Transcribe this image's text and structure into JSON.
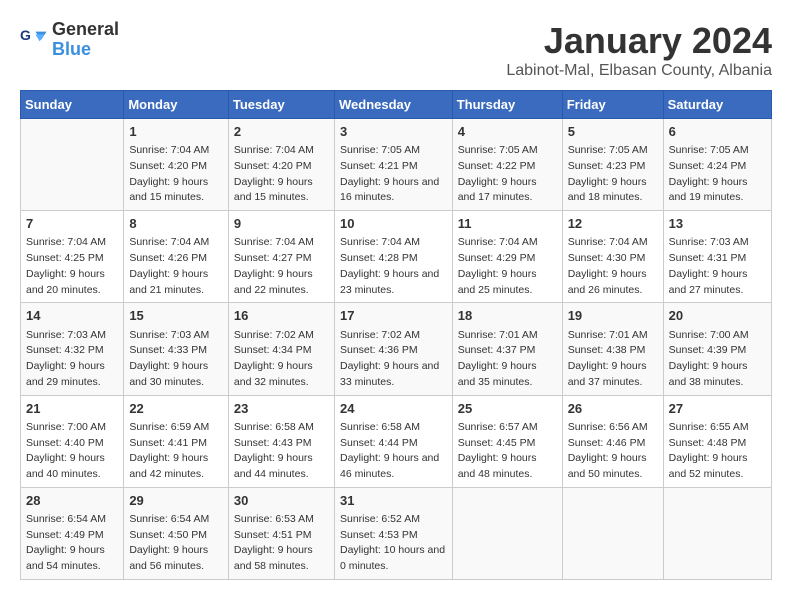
{
  "header": {
    "logo_line1": "General",
    "logo_line2": "Blue",
    "title": "January 2024",
    "subtitle": "Labinot-Mal, Elbasan County, Albania"
  },
  "weekdays": [
    "Sunday",
    "Monday",
    "Tuesday",
    "Wednesday",
    "Thursday",
    "Friday",
    "Saturday"
  ],
  "weeks": [
    [
      {
        "day": "",
        "sunrise": "",
        "sunset": "",
        "daylight": ""
      },
      {
        "day": "1",
        "sunrise": "Sunrise: 7:04 AM",
        "sunset": "Sunset: 4:20 PM",
        "daylight": "Daylight: 9 hours and 15 minutes."
      },
      {
        "day": "2",
        "sunrise": "Sunrise: 7:04 AM",
        "sunset": "Sunset: 4:20 PM",
        "daylight": "Daylight: 9 hours and 15 minutes."
      },
      {
        "day": "3",
        "sunrise": "Sunrise: 7:05 AM",
        "sunset": "Sunset: 4:21 PM",
        "daylight": "Daylight: 9 hours and 16 minutes."
      },
      {
        "day": "4",
        "sunrise": "Sunrise: 7:05 AM",
        "sunset": "Sunset: 4:22 PM",
        "daylight": "Daylight: 9 hours and 17 minutes."
      },
      {
        "day": "5",
        "sunrise": "Sunrise: 7:05 AM",
        "sunset": "Sunset: 4:23 PM",
        "daylight": "Daylight: 9 hours and 18 minutes."
      },
      {
        "day": "6",
        "sunrise": "Sunrise: 7:05 AM",
        "sunset": "Sunset: 4:24 PM",
        "daylight": "Daylight: 9 hours and 19 minutes."
      }
    ],
    [
      {
        "day": "7",
        "sunrise": "Sunrise: 7:04 AM",
        "sunset": "Sunset: 4:25 PM",
        "daylight": "Daylight: 9 hours and 20 minutes."
      },
      {
        "day": "8",
        "sunrise": "Sunrise: 7:04 AM",
        "sunset": "Sunset: 4:26 PM",
        "daylight": "Daylight: 9 hours and 21 minutes."
      },
      {
        "day": "9",
        "sunrise": "Sunrise: 7:04 AM",
        "sunset": "Sunset: 4:27 PM",
        "daylight": "Daylight: 9 hours and 22 minutes."
      },
      {
        "day": "10",
        "sunrise": "Sunrise: 7:04 AM",
        "sunset": "Sunset: 4:28 PM",
        "daylight": "Daylight: 9 hours and 23 minutes."
      },
      {
        "day": "11",
        "sunrise": "Sunrise: 7:04 AM",
        "sunset": "Sunset: 4:29 PM",
        "daylight": "Daylight: 9 hours and 25 minutes."
      },
      {
        "day": "12",
        "sunrise": "Sunrise: 7:04 AM",
        "sunset": "Sunset: 4:30 PM",
        "daylight": "Daylight: 9 hours and 26 minutes."
      },
      {
        "day": "13",
        "sunrise": "Sunrise: 7:03 AM",
        "sunset": "Sunset: 4:31 PM",
        "daylight": "Daylight: 9 hours and 27 minutes."
      }
    ],
    [
      {
        "day": "14",
        "sunrise": "Sunrise: 7:03 AM",
        "sunset": "Sunset: 4:32 PM",
        "daylight": "Daylight: 9 hours and 29 minutes."
      },
      {
        "day": "15",
        "sunrise": "Sunrise: 7:03 AM",
        "sunset": "Sunset: 4:33 PM",
        "daylight": "Daylight: 9 hours and 30 minutes."
      },
      {
        "day": "16",
        "sunrise": "Sunrise: 7:02 AM",
        "sunset": "Sunset: 4:34 PM",
        "daylight": "Daylight: 9 hours and 32 minutes."
      },
      {
        "day": "17",
        "sunrise": "Sunrise: 7:02 AM",
        "sunset": "Sunset: 4:36 PM",
        "daylight": "Daylight: 9 hours and 33 minutes."
      },
      {
        "day": "18",
        "sunrise": "Sunrise: 7:01 AM",
        "sunset": "Sunset: 4:37 PM",
        "daylight": "Daylight: 9 hours and 35 minutes."
      },
      {
        "day": "19",
        "sunrise": "Sunrise: 7:01 AM",
        "sunset": "Sunset: 4:38 PM",
        "daylight": "Daylight: 9 hours and 37 minutes."
      },
      {
        "day": "20",
        "sunrise": "Sunrise: 7:00 AM",
        "sunset": "Sunset: 4:39 PM",
        "daylight": "Daylight: 9 hours and 38 minutes."
      }
    ],
    [
      {
        "day": "21",
        "sunrise": "Sunrise: 7:00 AM",
        "sunset": "Sunset: 4:40 PM",
        "daylight": "Daylight: 9 hours and 40 minutes."
      },
      {
        "day": "22",
        "sunrise": "Sunrise: 6:59 AM",
        "sunset": "Sunset: 4:41 PM",
        "daylight": "Daylight: 9 hours and 42 minutes."
      },
      {
        "day": "23",
        "sunrise": "Sunrise: 6:58 AM",
        "sunset": "Sunset: 4:43 PM",
        "daylight": "Daylight: 9 hours and 44 minutes."
      },
      {
        "day": "24",
        "sunrise": "Sunrise: 6:58 AM",
        "sunset": "Sunset: 4:44 PM",
        "daylight": "Daylight: 9 hours and 46 minutes."
      },
      {
        "day": "25",
        "sunrise": "Sunrise: 6:57 AM",
        "sunset": "Sunset: 4:45 PM",
        "daylight": "Daylight: 9 hours and 48 minutes."
      },
      {
        "day": "26",
        "sunrise": "Sunrise: 6:56 AM",
        "sunset": "Sunset: 4:46 PM",
        "daylight": "Daylight: 9 hours and 50 minutes."
      },
      {
        "day": "27",
        "sunrise": "Sunrise: 6:55 AM",
        "sunset": "Sunset: 4:48 PM",
        "daylight": "Daylight: 9 hours and 52 minutes."
      }
    ],
    [
      {
        "day": "28",
        "sunrise": "Sunrise: 6:54 AM",
        "sunset": "Sunset: 4:49 PM",
        "daylight": "Daylight: 9 hours and 54 minutes."
      },
      {
        "day": "29",
        "sunrise": "Sunrise: 6:54 AM",
        "sunset": "Sunset: 4:50 PM",
        "daylight": "Daylight: 9 hours and 56 minutes."
      },
      {
        "day": "30",
        "sunrise": "Sunrise: 6:53 AM",
        "sunset": "Sunset: 4:51 PM",
        "daylight": "Daylight: 9 hours and 58 minutes."
      },
      {
        "day": "31",
        "sunrise": "Sunrise: 6:52 AM",
        "sunset": "Sunset: 4:53 PM",
        "daylight": "Daylight: 10 hours and 0 minutes."
      },
      {
        "day": "",
        "sunrise": "",
        "sunset": "",
        "daylight": ""
      },
      {
        "day": "",
        "sunrise": "",
        "sunset": "",
        "daylight": ""
      },
      {
        "day": "",
        "sunrise": "",
        "sunset": "",
        "daylight": ""
      }
    ]
  ]
}
